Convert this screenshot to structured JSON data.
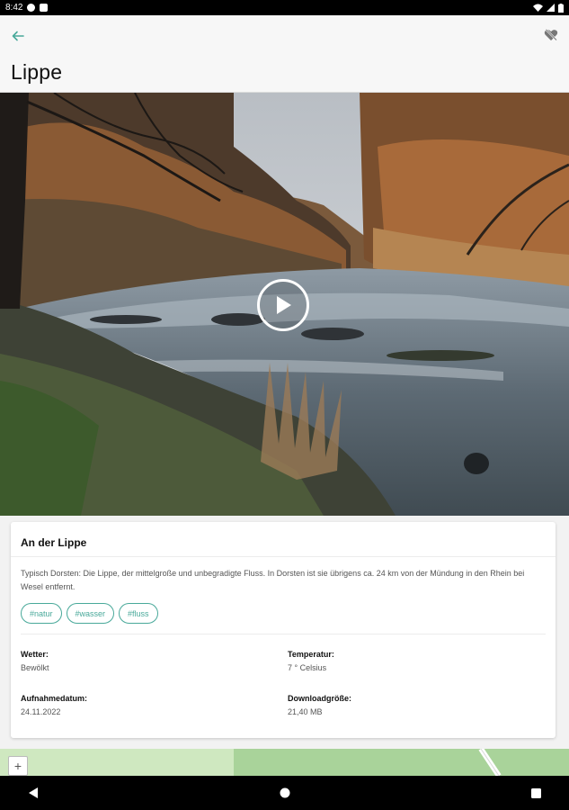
{
  "status_bar": {
    "time": "8:42"
  },
  "app_bar": {
    "title": "Lippe"
  },
  "details": {
    "heading": "An der Lippe",
    "description": "Typisch Dorsten: Die Lippe, der mittelgroße und unbegradigte Fluss. In Dorsten ist sie übrigens ca. 24 km von der Mündung in den Rhein bei Wesel entfernt.",
    "tags": [
      "#natur",
      "#wasser",
      "#fluss"
    ],
    "fields": {
      "weather_label": "Wetter:",
      "weather_value": "Bewölkt",
      "temperature_label": "Temperatur:",
      "temperature_value": "7 ° Celsius",
      "date_label": "Aufnahmedatum:",
      "date_value": "24.11.2022",
      "size_label": "Downloadgröße:",
      "size_value": "21,40 MB"
    }
  },
  "map": {
    "zoom_in_label": "+"
  },
  "colors": {
    "accent": "#49a99a",
    "appbar": "#f7f7f7",
    "background": "#f2f2f2"
  }
}
